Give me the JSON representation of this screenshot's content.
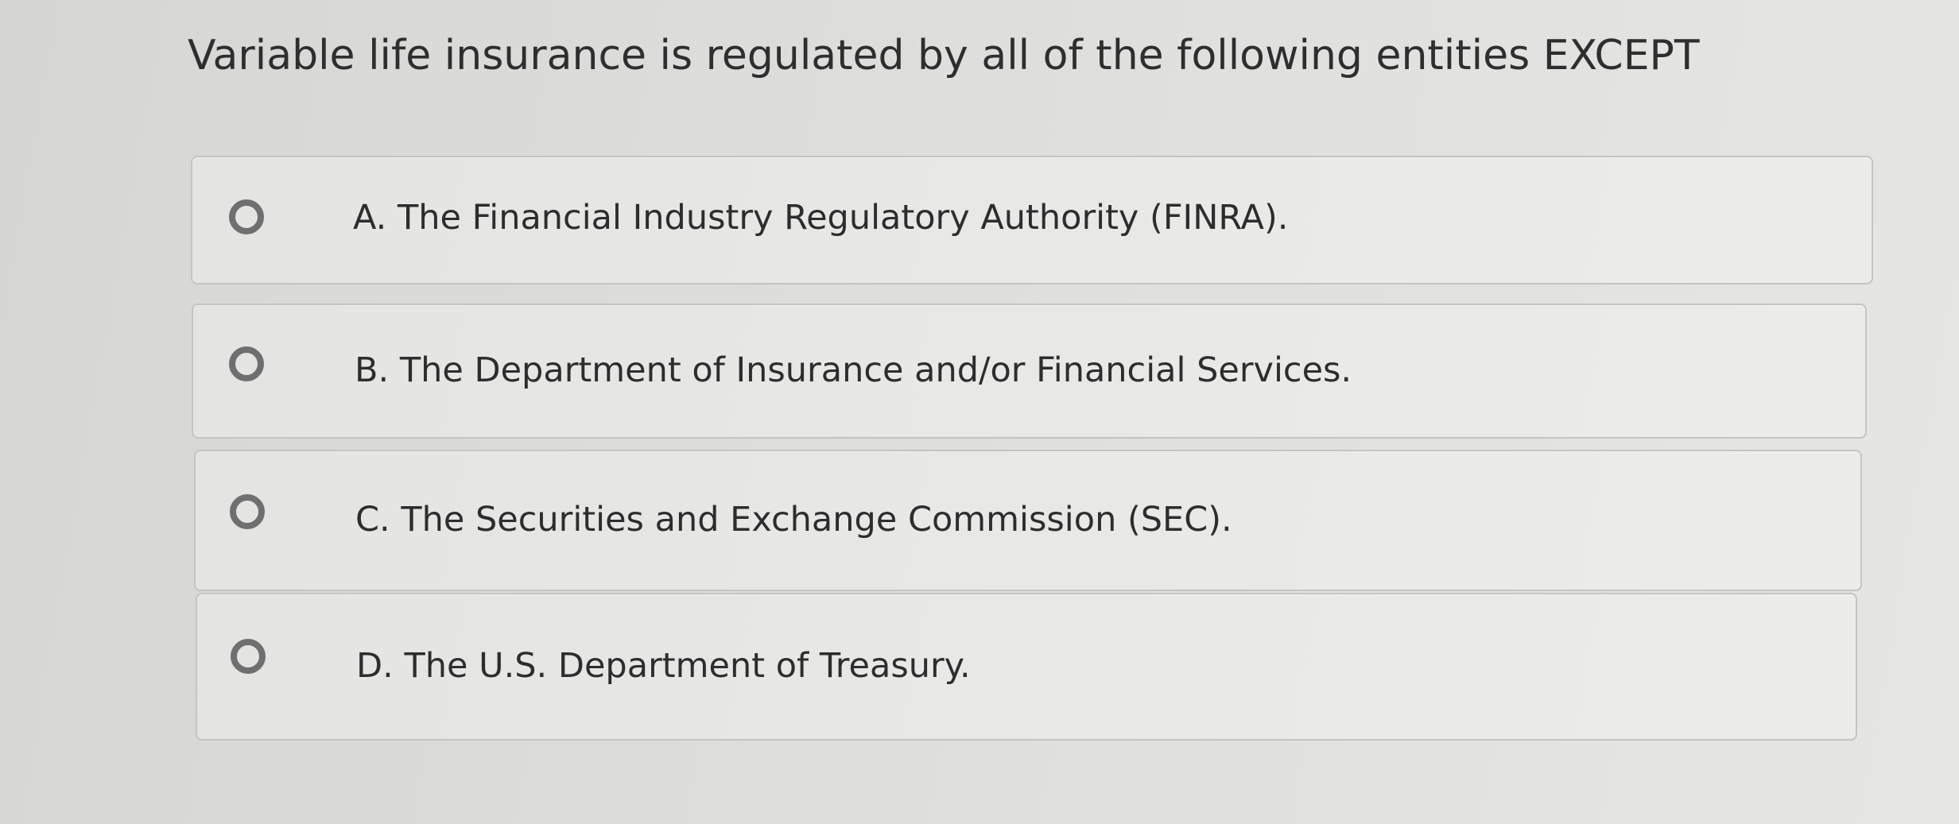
{
  "question": {
    "text": "Variable life insurance is regulated by all of the following entities EXCEPT"
  },
  "options": [
    {
      "label": "A. The Financial Industry Regulatory Authority (FINRA).",
      "selected": false
    },
    {
      "label": "B. The Department of Insurance and/or Financial Services.",
      "selected": false
    },
    {
      "label": "C. The Securities and Exchange Commission (SEC).",
      "selected": false
    },
    {
      "label": "D. The U.S. Department of Treasury.",
      "selected": false
    }
  ]
}
